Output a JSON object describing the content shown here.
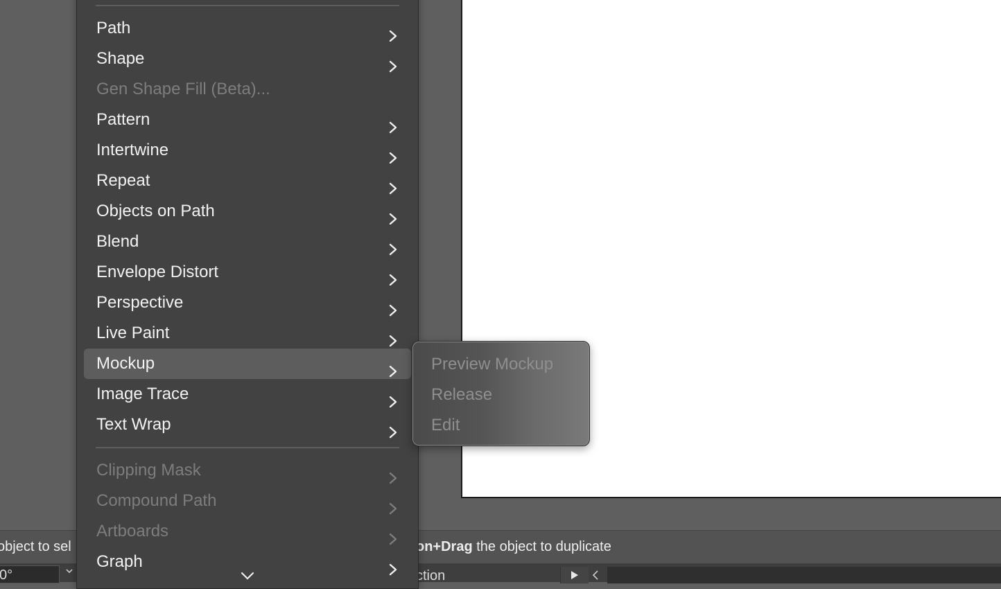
{
  "status": {
    "left_text": "object to sel",
    "right_bold": "on+Drag",
    "right_text": " the object to duplicate"
  },
  "bottom": {
    "angle_value": "0°",
    "selection_text": "ction"
  },
  "menu": {
    "items": [
      {
        "label": "Path",
        "enabled": true,
        "submenu": true
      },
      {
        "label": "Shape",
        "enabled": true,
        "submenu": true
      },
      {
        "label": "Gen Shape Fill (Beta)...",
        "enabled": false,
        "submenu": false
      },
      {
        "label": "Pattern",
        "enabled": true,
        "submenu": true
      },
      {
        "label": "Intertwine",
        "enabled": true,
        "submenu": true
      },
      {
        "label": "Repeat",
        "enabled": true,
        "submenu": true
      },
      {
        "label": "Objects on Path",
        "enabled": true,
        "submenu": true
      },
      {
        "label": "Blend",
        "enabled": true,
        "submenu": true
      },
      {
        "label": "Envelope Distort",
        "enabled": true,
        "submenu": true
      },
      {
        "label": "Perspective",
        "enabled": true,
        "submenu": true
      },
      {
        "label": "Live Paint",
        "enabled": true,
        "submenu": true
      },
      {
        "label": "Mockup",
        "enabled": true,
        "submenu": true,
        "highlighted": true
      },
      {
        "label": "Image Trace",
        "enabled": true,
        "submenu": true
      },
      {
        "label": "Text Wrap",
        "enabled": true,
        "submenu": true
      },
      {
        "label": "Clipping Mask",
        "enabled": false,
        "submenu": true
      },
      {
        "label": "Compound Path",
        "enabled": false,
        "submenu": true
      },
      {
        "label": "Artboards",
        "enabled": false,
        "submenu": true
      },
      {
        "label": "Graph",
        "enabled": true,
        "submenu": true
      }
    ]
  },
  "submenu": {
    "items": [
      {
        "label": "Preview Mockup",
        "enabled": false
      },
      {
        "label": "Release",
        "enabled": false
      },
      {
        "label": "Edit",
        "enabled": false
      }
    ]
  },
  "colors": {
    "canvas": "#5f5f5f",
    "menu_bg": "#424242",
    "highlight": "#5d5d5d",
    "disabled_text": "#7d7d7d"
  }
}
